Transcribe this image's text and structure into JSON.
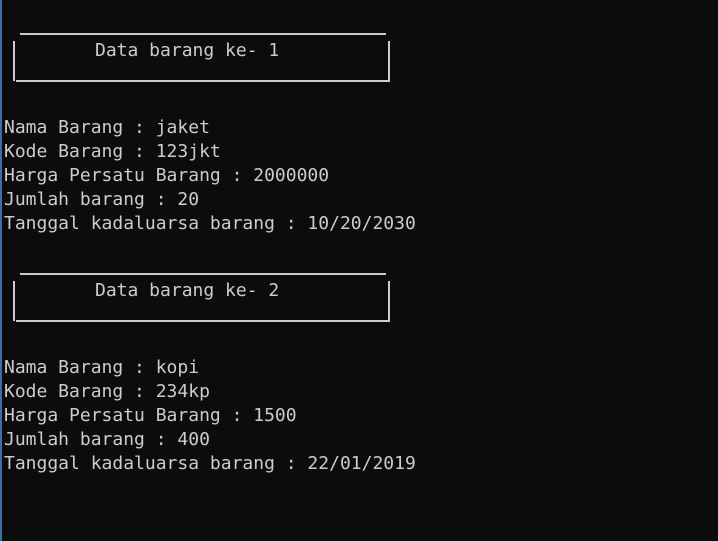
{
  "records": [
    {
      "title": "Data barang ke- 1",
      "nama": "Nama Barang : jaket",
      "kode": "Kode Barang : 123jkt",
      "harga": "Harga Persatu Barang : 2000000",
      "jumlah": "Jumlah barang : 20",
      "tanggal": "Tanggal kadaluarsa barang : 10/20/2030"
    },
    {
      "title": "Data barang ke- 2",
      "nama": "Nama Barang : kopi",
      "kode": "Kode Barang : 234kp",
      "harga": "Harga Persatu Barang : 1500",
      "jumlah": "Jumlah barang : 400",
      "tanggal": "Tanggal kadaluarsa barang : 22/01/2019"
    }
  ],
  "colors": {
    "background": "#0c0c0c",
    "text": "#cccccc"
  }
}
